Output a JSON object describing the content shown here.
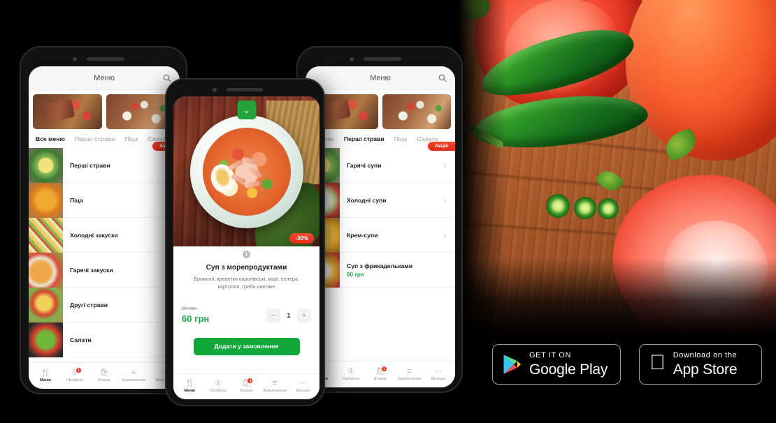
{
  "app": {
    "header_title": "Меню",
    "search_icon": "search-icon"
  },
  "left_phone": {
    "tabs": [
      {
        "label": "Все меню",
        "active": true
      },
      {
        "label": "Перші страви",
        "active": false
      },
      {
        "label": "Піца",
        "active": false
      },
      {
        "label": "Салати",
        "active": false
      }
    ],
    "promo_badge": "Акція",
    "rows": [
      {
        "name": "Перші страви",
        "price": "",
        "badge": "Акція"
      },
      {
        "name": "Піца",
        "price": "",
        "badge": ""
      },
      {
        "name": "Холодні закуски",
        "price": "",
        "badge": ""
      },
      {
        "name": "Гарячі закуски",
        "price": "",
        "badge": ""
      },
      {
        "name": "Другі страви",
        "price": "",
        "badge": ""
      },
      {
        "name": "Салати",
        "price": "",
        "badge": ""
      }
    ]
  },
  "right_phone": {
    "tabs": [
      {
        "label": "е меню",
        "active": false
      },
      {
        "label": "Перші страви",
        "active": true
      },
      {
        "label": "Піца",
        "active": false
      },
      {
        "label": "Салати",
        "active": false
      }
    ],
    "rows": [
      {
        "name": "Гарячі супи",
        "price": "",
        "badge": "Акція"
      },
      {
        "name": "Холодні супи",
        "price": "",
        "badge": ""
      },
      {
        "name": "Крем-супи",
        "price": "",
        "badge": ""
      },
      {
        "name": "Суп з фрикадельками",
        "price": "60 грн",
        "badge": ""
      }
    ]
  },
  "center_phone": {
    "collapse_icon": "chevron-down-icon",
    "discount_badge": "-30%",
    "info_icon": "info-icon",
    "dish_title": "Суп з морепродуктами",
    "dish_description": "Брокколі, креветки королівські, мідії, селера, картопля, гриби шиітаке",
    "old_price": "80 грн",
    "new_price": "60 грн",
    "quantity": "1",
    "decrement_label": "−",
    "increment_label": "+",
    "add_button": "Додати у замовлення"
  },
  "bottom_nav": {
    "items": [
      {
        "label": "Меню",
        "icon": "cutlery-icon",
        "badge": "",
        "active": true
      },
      {
        "label": "Профіль",
        "icon": "user-circle-icon",
        "badge": "1",
        "active": false
      },
      {
        "label": "Кошик",
        "icon": "bag-icon",
        "badge": "",
        "active": false
      },
      {
        "label": "Замовлення",
        "icon": "list-icon",
        "badge": "",
        "active": false
      },
      {
        "label": "Більше",
        "icon": "ellipsis-icon",
        "badge": "",
        "active": false
      }
    ],
    "items_center": [
      {
        "label": "Меню",
        "icon": "cutlery-icon",
        "badge": "",
        "active": true
      },
      {
        "label": "Профіль",
        "icon": "user-circle-icon",
        "badge": "",
        "active": false
      },
      {
        "label": "Кошик",
        "icon": "bag-icon",
        "badge": "1",
        "active": false
      },
      {
        "label": "Замовлення",
        "icon": "list-icon",
        "badge": "",
        "active": false
      },
      {
        "label": "Більше",
        "icon": "ellipsis-icon",
        "badge": "",
        "active": false
      }
    ]
  },
  "store_badges": {
    "google": {
      "top": "GET IT ON",
      "bottom": "Google Play",
      "icon": "google-play-icon"
    },
    "apple": {
      "top": "Download on the",
      "bottom": "App Store",
      "icon": "apple-icon"
    }
  },
  "colors": {
    "brand_green": "#11a83b",
    "price_green": "#1cae4b",
    "badge_red": "#e2291a",
    "background": "#000000"
  }
}
